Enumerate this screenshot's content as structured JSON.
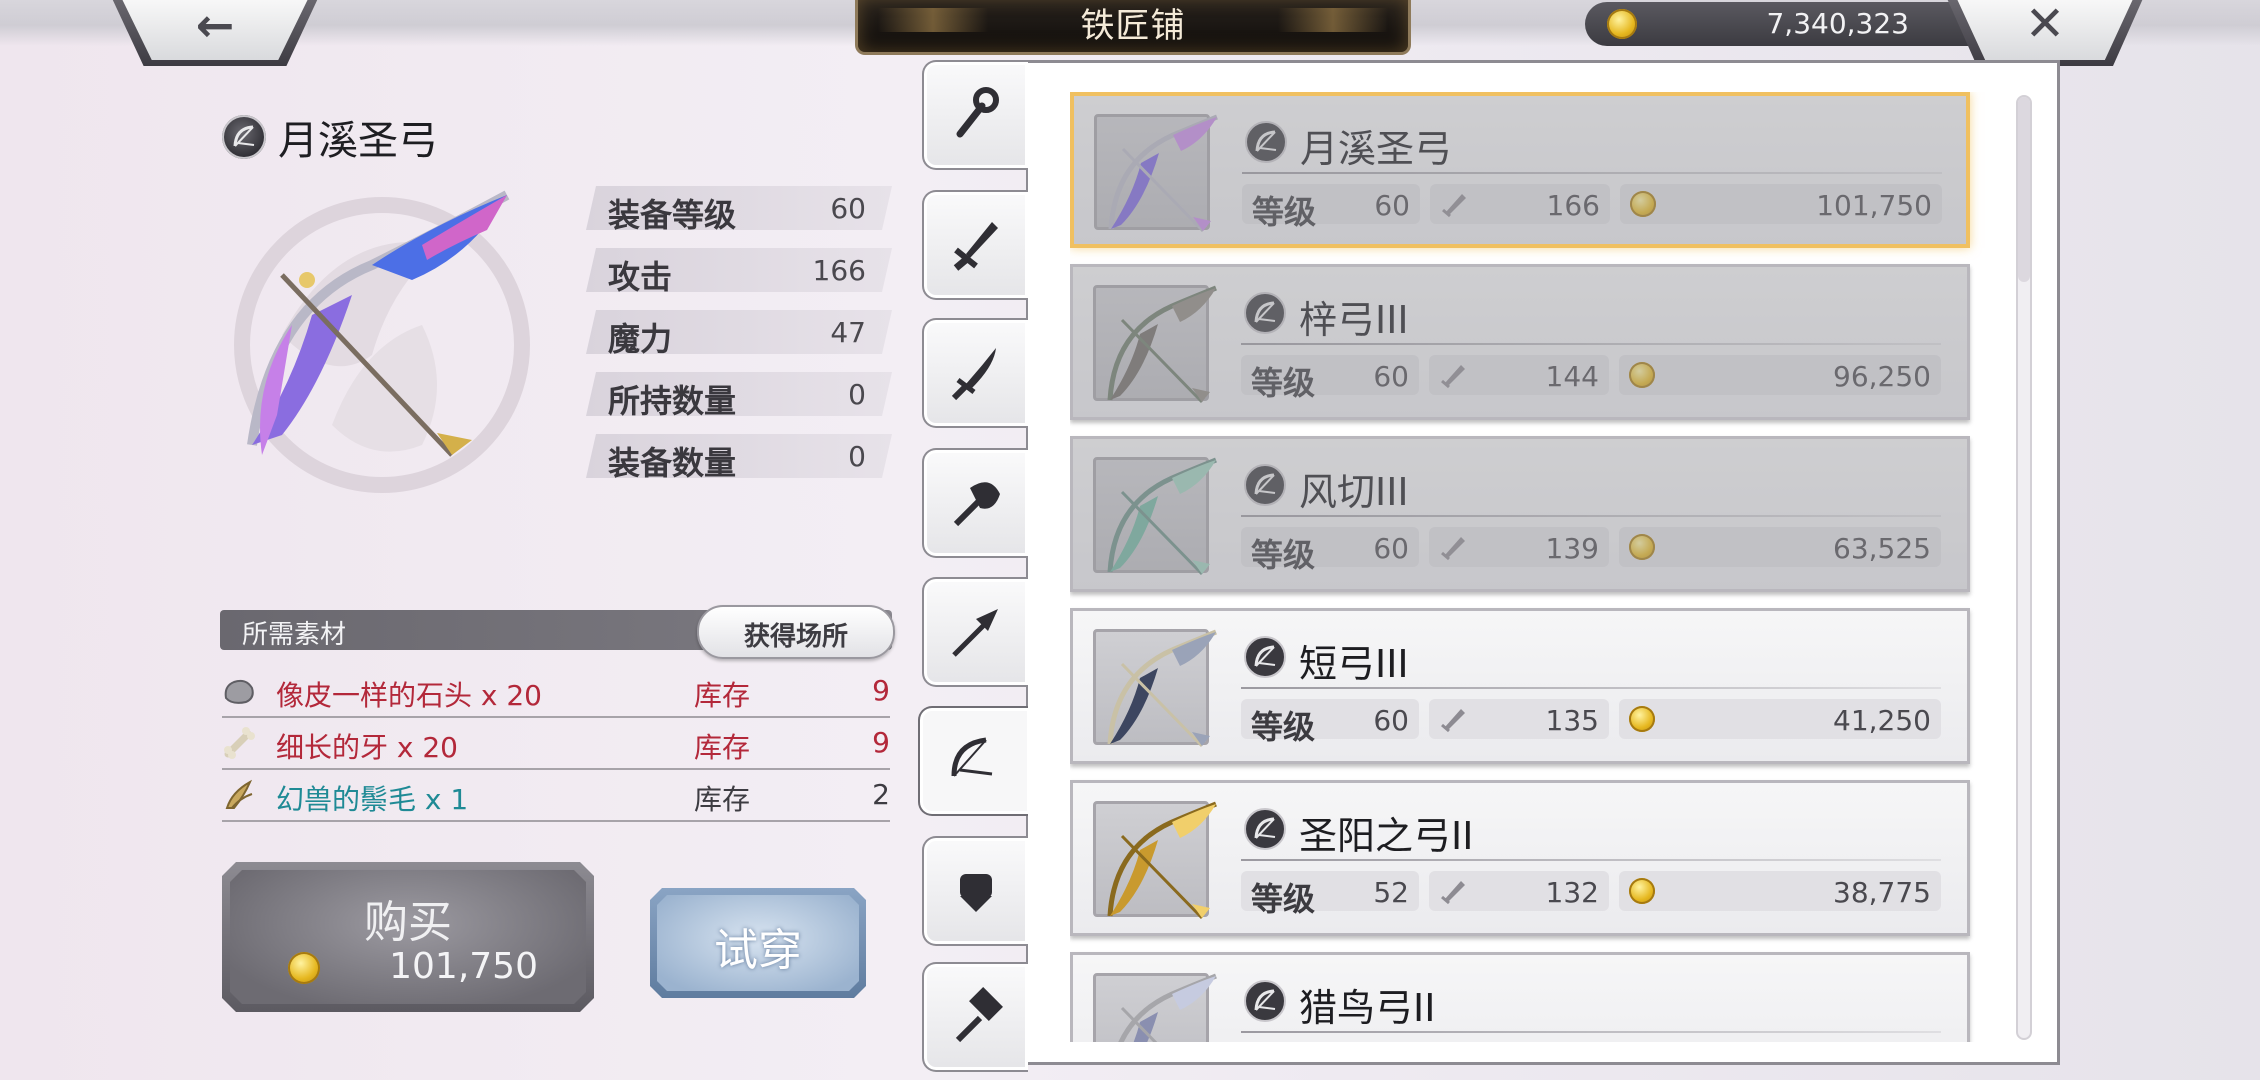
{
  "header": {
    "title": "铁匠铺",
    "gold": "7,340,323",
    "back_glyph": "←",
    "close_glyph": "✕"
  },
  "selected_item": {
    "name": "月溪圣弓",
    "stats": [
      {
        "label": "装备等级",
        "value": "60"
      },
      {
        "label": "攻击",
        "value": "166"
      },
      {
        "label": "魔力",
        "value": "47"
      },
      {
        "label": "所持数量",
        "value": "0"
      },
      {
        "label": "装备数量",
        "value": "0"
      }
    ]
  },
  "materials": {
    "header": "所需素材",
    "source_button": "获得场所",
    "items": [
      {
        "name": "像皮一样的石头 x 20",
        "stock_label": "库存",
        "stock": "9",
        "icon": "stone-icon",
        "color": "#b3283a"
      },
      {
        "name": "细长的牙 x 20",
        "stock_label": "库存",
        "stock": "9",
        "icon": "bone-icon",
        "color": "#b3283a"
      },
      {
        "name": "幻兽的鬃毛 x 1",
        "stock_label": "库存",
        "stock": "2",
        "icon": "mane-icon",
        "color": "#1f8a95"
      }
    ]
  },
  "actions": {
    "buy_label": "购买",
    "buy_price": "101,750",
    "try_label": "试穿"
  },
  "tabs": [
    {
      "icon": "staff-icon",
      "active": false
    },
    {
      "icon": "sword-icon",
      "active": false
    },
    {
      "icon": "katana-icon",
      "active": false
    },
    {
      "icon": "axe-icon",
      "active": false
    },
    {
      "icon": "spear-icon",
      "active": false
    },
    {
      "icon": "bow-icon",
      "active": true
    },
    {
      "icon": "fist-icon",
      "active": false
    },
    {
      "icon": "hammer-icon",
      "active": false
    }
  ],
  "list": {
    "level_label": "等级",
    "items": [
      {
        "name": "月溪圣弓",
        "level": "60",
        "attack": "166",
        "price": "101,750",
        "selected": true,
        "dim": true
      },
      {
        "name": "梓弓III",
        "level": "60",
        "attack": "144",
        "price": "96,250",
        "selected": false,
        "dim": true
      },
      {
        "name": "风切III",
        "level": "60",
        "attack": "139",
        "price": "63,525",
        "selected": false,
        "dim": true
      },
      {
        "name": "短弓III",
        "level": "60",
        "attack": "135",
        "price": "41,250",
        "selected": false,
        "dim": false
      },
      {
        "name": "圣阳之弓II",
        "level": "52",
        "attack": "132",
        "price": "38,775",
        "selected": false,
        "dim": false
      },
      {
        "name": "猎鸟弓II",
        "level": "",
        "attack": "",
        "price": "",
        "selected": false,
        "dim": false
      }
    ]
  },
  "colors": {
    "accent_gold": "#f0c060",
    "material_red": "#b3283a",
    "material_teal": "#1f8a95"
  }
}
